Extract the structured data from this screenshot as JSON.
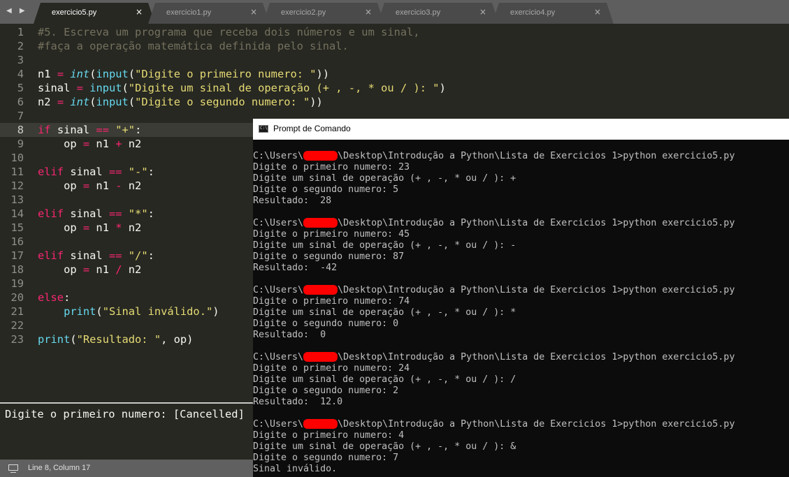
{
  "tabs": [
    {
      "label": "exercicio5.py",
      "active": true
    },
    {
      "label": "exercicio1.py",
      "active": false
    },
    {
      "label": "exercicio2.py",
      "active": false
    },
    {
      "label": "exercicio3.py",
      "active": false
    },
    {
      "label": "exercicio4.py",
      "active": false
    }
  ],
  "tab_nav": "◀ ▶",
  "tab_close_glyph": "×",
  "editor": {
    "current_line": 8,
    "lines": [
      {
        "n": "1",
        "tokens": [
          [
            "cm",
            "#5. Escreva um programa que receba dois números e um sinal,"
          ]
        ]
      },
      {
        "n": "2",
        "tokens": [
          [
            "cm",
            "#faça a operação matemática definida pelo sinal."
          ]
        ]
      },
      {
        "n": "3",
        "tokens": []
      },
      {
        "n": "4",
        "tokens": [
          [
            "tx",
            "n1 "
          ],
          [
            "kw",
            "="
          ],
          [
            "tx",
            " "
          ],
          [
            "ty",
            "int"
          ],
          [
            "tx",
            "("
          ],
          [
            "fn",
            "input"
          ],
          [
            "tx",
            "("
          ],
          [
            "st",
            "\"Digite o primeiro numero: \""
          ],
          [
            "tx",
            "))"
          ]
        ]
      },
      {
        "n": "5",
        "tokens": [
          [
            "tx",
            "sinal "
          ],
          [
            "kw",
            "="
          ],
          [
            "tx",
            " "
          ],
          [
            "fn",
            "input"
          ],
          [
            "tx",
            "("
          ],
          [
            "st",
            "\"Digite um sinal de operação (+ , -, * ou / ): \""
          ],
          [
            "tx",
            ")"
          ]
        ]
      },
      {
        "n": "6",
        "tokens": [
          [
            "tx",
            "n2 "
          ],
          [
            "kw",
            "="
          ],
          [
            "tx",
            " "
          ],
          [
            "ty",
            "int"
          ],
          [
            "tx",
            "("
          ],
          [
            "fn",
            "input"
          ],
          [
            "tx",
            "("
          ],
          [
            "st",
            "\"Digite o segundo numero: \""
          ],
          [
            "tx",
            "))"
          ]
        ]
      },
      {
        "n": "7",
        "tokens": []
      },
      {
        "n": "8",
        "tokens": [
          [
            "kw",
            "if"
          ],
          [
            "tx",
            " sinal "
          ],
          [
            "kw",
            "=="
          ],
          [
            "tx",
            " "
          ],
          [
            "st",
            "\"+\""
          ],
          [
            "tx",
            ":"
          ]
        ]
      },
      {
        "n": "9",
        "tokens": [
          [
            "tx",
            "    op "
          ],
          [
            "kw",
            "="
          ],
          [
            "tx",
            " n1 "
          ],
          [
            "kw",
            "+"
          ],
          [
            "tx",
            " n2"
          ]
        ]
      },
      {
        "n": "10",
        "tokens": []
      },
      {
        "n": "11",
        "tokens": [
          [
            "kw",
            "elif"
          ],
          [
            "tx",
            " sinal "
          ],
          [
            "kw",
            "=="
          ],
          [
            "tx",
            " "
          ],
          [
            "st",
            "\"-\""
          ],
          [
            "tx",
            ":"
          ]
        ]
      },
      {
        "n": "12",
        "tokens": [
          [
            "tx",
            "    op "
          ],
          [
            "kw",
            "="
          ],
          [
            "tx",
            " n1 "
          ],
          [
            "kw",
            "-"
          ],
          [
            "tx",
            " n2"
          ]
        ]
      },
      {
        "n": "13",
        "tokens": []
      },
      {
        "n": "14",
        "tokens": [
          [
            "kw",
            "elif"
          ],
          [
            "tx",
            " sinal "
          ],
          [
            "kw",
            "=="
          ],
          [
            "tx",
            " "
          ],
          [
            "st",
            "\"*\""
          ],
          [
            "tx",
            ":"
          ]
        ]
      },
      {
        "n": "15",
        "tokens": [
          [
            "tx",
            "    op "
          ],
          [
            "kw",
            "="
          ],
          [
            "tx",
            " n1 "
          ],
          [
            "kw",
            "*"
          ],
          [
            "tx",
            " n2"
          ]
        ]
      },
      {
        "n": "16",
        "tokens": []
      },
      {
        "n": "17",
        "tokens": [
          [
            "kw",
            "elif"
          ],
          [
            "tx",
            " sinal "
          ],
          [
            "kw",
            "=="
          ],
          [
            "tx",
            " "
          ],
          [
            "st",
            "\"/\""
          ],
          [
            "tx",
            ":"
          ]
        ]
      },
      {
        "n": "18",
        "tokens": [
          [
            "tx",
            "    op "
          ],
          [
            "kw",
            "="
          ],
          [
            "tx",
            " n1 "
          ],
          [
            "kw",
            "/"
          ],
          [
            "tx",
            " n2"
          ]
        ]
      },
      {
        "n": "19",
        "tokens": []
      },
      {
        "n": "20",
        "tokens": [
          [
            "kw",
            "else"
          ],
          [
            "tx",
            ":"
          ]
        ]
      },
      {
        "n": "21",
        "tokens": [
          [
            "tx",
            "    "
          ],
          [
            "fn",
            "print"
          ],
          [
            "tx",
            "("
          ],
          [
            "st",
            "\"Sinal inválido.\""
          ],
          [
            "tx",
            ")"
          ]
        ]
      },
      {
        "n": "22",
        "tokens": []
      },
      {
        "n": "23",
        "tokens": [
          [
            "fn",
            "print"
          ],
          [
            "tx",
            "("
          ],
          [
            "st",
            "\"Resultado: \""
          ],
          [
            "tx",
            ", op)"
          ]
        ]
      }
    ]
  },
  "output_panel": {
    "text": "Digite o primeiro numero: [Cancelled]"
  },
  "statusbar": {
    "text": "Line 8, Column 17"
  },
  "cmd": {
    "title": "Prompt de Comando",
    "icon_text": "C:\\",
    "lines": [
      {
        "type": "path",
        "before": "C:\\Users\\",
        "after": "\\Desktop\\Introdução a Python\\Lista de Exercicios 1>python exercicio5.py"
      },
      {
        "text": "Digite o primeiro numero: 23"
      },
      {
        "text": "Digite um sinal de operação (+ , -, * ou / ): +"
      },
      {
        "text": "Digite o segundo numero: 5"
      },
      {
        "text": "Resultado:  28"
      },
      {
        "text": ""
      },
      {
        "type": "path",
        "before": "C:\\Users\\",
        "after": "\\Desktop\\Introdução a Python\\Lista de Exercicios 1>python exercicio5.py"
      },
      {
        "text": "Digite o primeiro numero: 45"
      },
      {
        "text": "Digite um sinal de operação (+ , -, * ou / ): -"
      },
      {
        "text": "Digite o segundo numero: 87"
      },
      {
        "text": "Resultado:  -42"
      },
      {
        "text": ""
      },
      {
        "type": "path",
        "before": "C:\\Users\\",
        "after": "\\Desktop\\Introdução a Python\\Lista de Exercicios 1>python exercicio5.py"
      },
      {
        "text": "Digite o primeiro numero: 74"
      },
      {
        "text": "Digite um sinal de operação (+ , -, * ou / ): *"
      },
      {
        "text": "Digite o segundo numero: 0"
      },
      {
        "text": "Resultado:  0"
      },
      {
        "text": ""
      },
      {
        "type": "path",
        "before": "C:\\Users\\",
        "after": "\\Desktop\\Introdução a Python\\Lista de Exercicios 1>python exercicio5.py"
      },
      {
        "text": "Digite o primeiro numero: 24"
      },
      {
        "text": "Digite um sinal de operação (+ , -, * ou / ): /"
      },
      {
        "text": "Digite o segundo numero: 2"
      },
      {
        "text": "Resultado:  12.0"
      },
      {
        "text": ""
      },
      {
        "type": "path",
        "before": "C:\\Users\\",
        "after": "\\Desktop\\Introdução a Python\\Lista de Exercicios 1>python exercicio5.py"
      },
      {
        "text": "Digite o primeiro numero: 4"
      },
      {
        "text": "Digite um sinal de operação (+ , -, * ou / ): &"
      },
      {
        "text": "Digite o segundo numero: 7"
      },
      {
        "text": "Sinal inválido."
      }
    ]
  },
  "colors": {
    "editor_bg": "#272822",
    "keyword": "#f92672",
    "function": "#66d9ef",
    "string": "#e6db74",
    "comment": "#75715e",
    "redaction": "#ff0000",
    "console_text": "#c0c0c0"
  }
}
